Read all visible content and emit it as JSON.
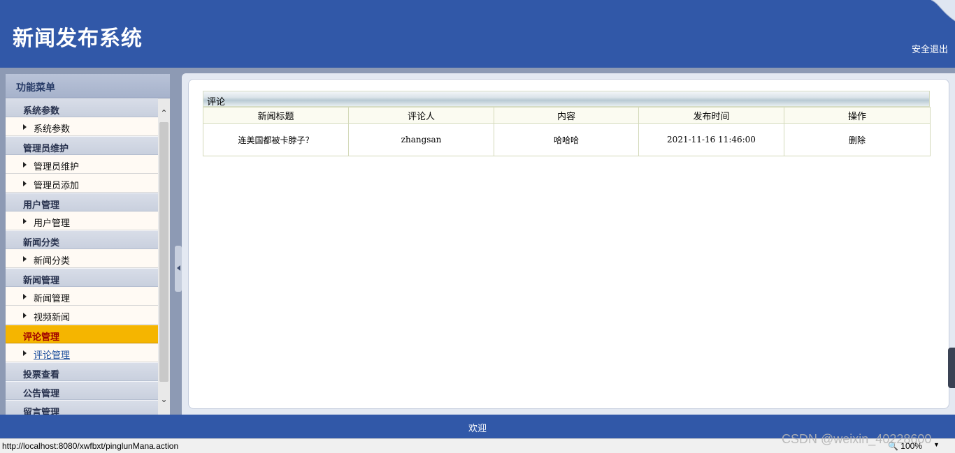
{
  "header": {
    "title": "新闻发布系统",
    "logout_label": "安全退出"
  },
  "sidebar": {
    "heading": "功能菜单",
    "groups": [
      {
        "label": "系统参数",
        "items": [
          {
            "label": "系统参数"
          }
        ]
      },
      {
        "label": "管理员维护",
        "items": [
          {
            "label": "管理员维护"
          },
          {
            "label": "管理员添加"
          }
        ]
      },
      {
        "label": "用户管理",
        "items": [
          {
            "label": "用户管理"
          }
        ]
      },
      {
        "label": "新闻分类",
        "items": [
          {
            "label": "新闻分类"
          }
        ]
      },
      {
        "label": "新闻管理",
        "items": [
          {
            "label": "新闻管理"
          },
          {
            "label": "视频新闻"
          }
        ]
      },
      {
        "label": "评论管理",
        "items": [
          {
            "label": "评论管理"
          }
        ]
      },
      {
        "label": "投票查看",
        "items": []
      },
      {
        "label": "公告管理",
        "items": []
      },
      {
        "label": "留言管理",
        "items": []
      }
    ],
    "active_group": "评论管理"
  },
  "table": {
    "caption": "评论",
    "columns": [
      "新闻标题",
      "评论人",
      "内容",
      "发布时间",
      "操作"
    ],
    "rows": [
      {
        "title": "连美国都被卡脖子？",
        "commenter": "zhangsan",
        "content": "哈哈哈",
        "time": "2021-11-16 11:46:00",
        "action": "删除"
      }
    ]
  },
  "footer": {
    "text": "欢迎"
  },
  "statusbar": {
    "url": "http://localhost:8080/xwfbxt/pinglunMana.action",
    "zoom": "100%"
  },
  "watermark": "CSDN @weixin_40228600",
  "colors": {
    "header_bg": "#3158a8",
    "active_group_bg": "#f5b500",
    "active_group_text": "#a00000"
  }
}
